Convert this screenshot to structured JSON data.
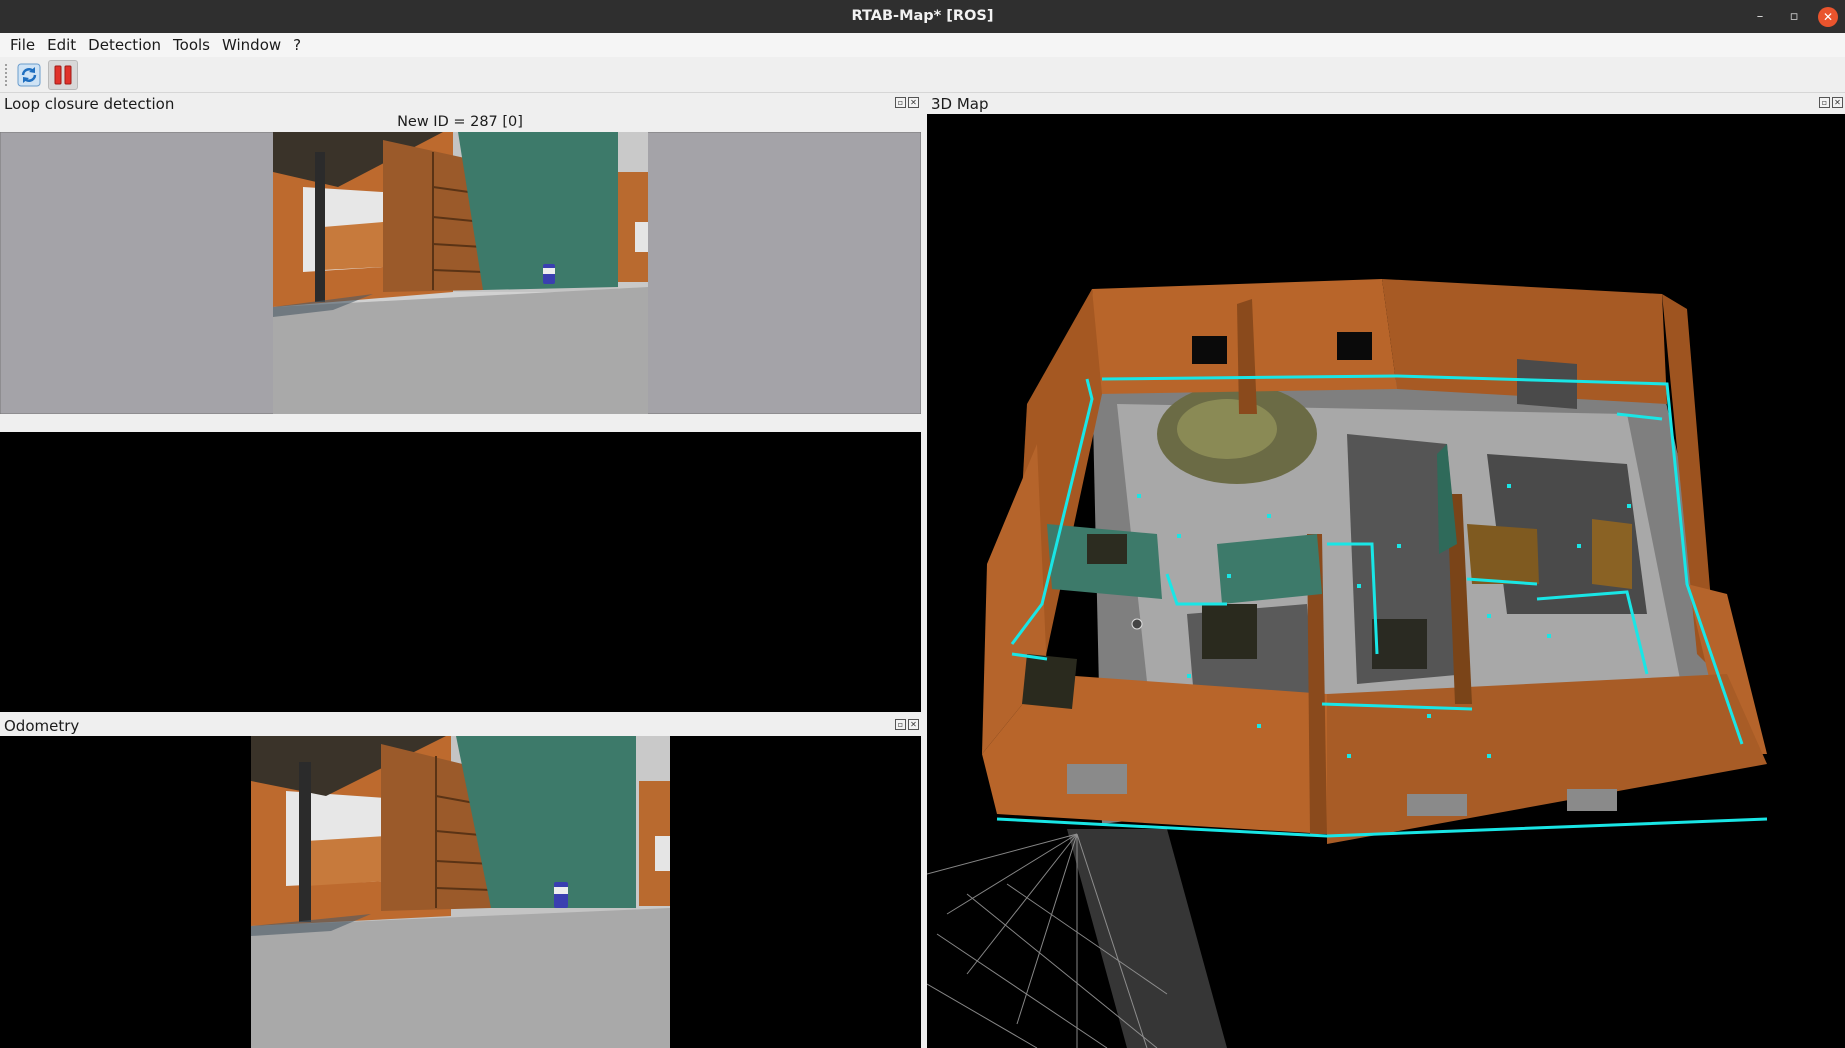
{
  "window": {
    "title": "RTAB-Map* [ROS]",
    "minimize": "–",
    "maximize": "▫",
    "close": "✕"
  },
  "menu": [
    "File",
    "Edit",
    "Detection",
    "Tools",
    "Window",
    "?"
  ],
  "toolbar": {
    "buttons": [
      {
        "icon": "refresh-icon",
        "pressed": false
      },
      {
        "icon": "pause-icon",
        "pressed": true
      }
    ]
  },
  "docks": {
    "loop_closure": {
      "title": "Loop closure detection",
      "info": "New ID = 287 [0]"
    },
    "odometry": {
      "title": "Odometry"
    },
    "map3d": {
      "title": "3D Map"
    },
    "button_float": "▫",
    "button_close": "✕"
  },
  "colors": {
    "titlebar": "#2f2f2f",
    "close_button": "#e9542d",
    "wall": "#b8652a",
    "floor": "#a9a9a9",
    "cyan_features": "#19e6e6",
    "teal_wall": "#3d7a6a"
  }
}
